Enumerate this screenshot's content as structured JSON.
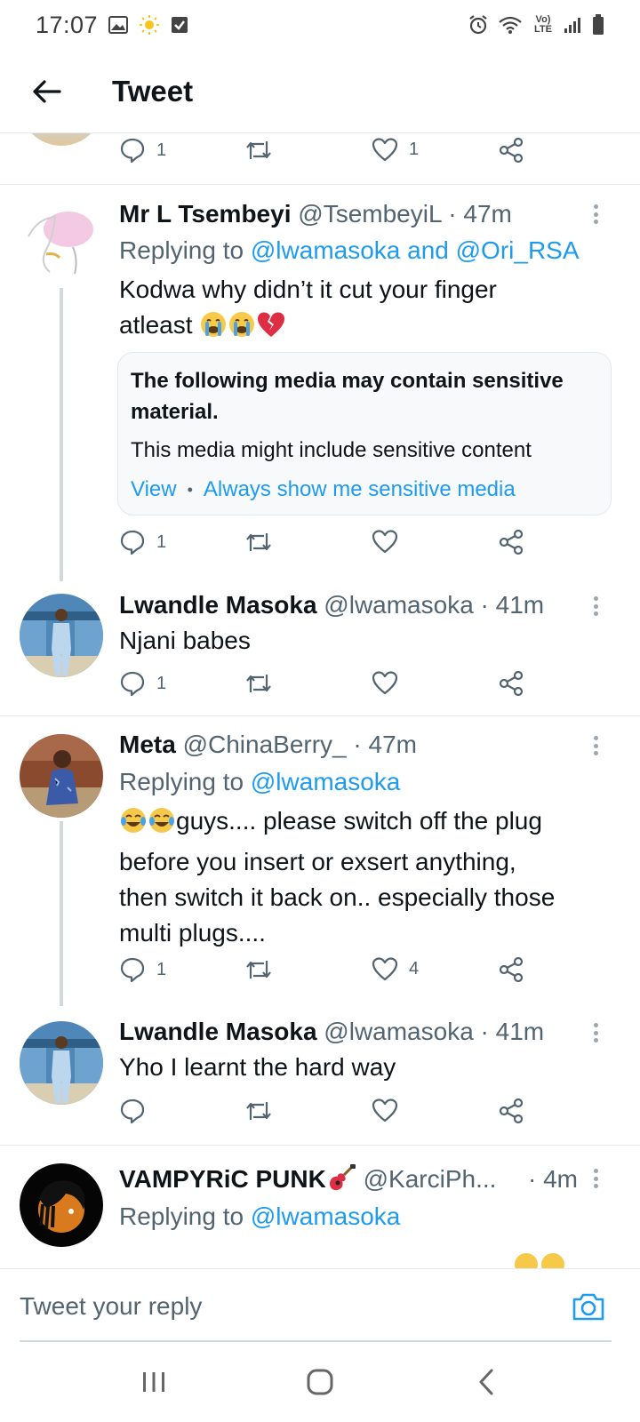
{
  "status_bar": {
    "time": "17:07",
    "network_label": "Vo) LTE"
  },
  "header": {
    "title": "Tweet"
  },
  "top_actions": {
    "replies": "1",
    "retweets": "",
    "likes": "1"
  },
  "tweets": [
    {
      "name": "Mr L Tsembeyi",
      "meta": "@TsembeyiL · 47m",
      "replying_prefix": "Replying to ",
      "replying_to": "@lwamasoka and @Ori_RSA",
      "text_line1": "Kodwa why didn’t it cut your finger",
      "text_line2": "atleast",
      "sensitive": {
        "title": "The following media may contain sensitive material.",
        "body": "This media might include sensitive content",
        "view": "View",
        "separator": "•",
        "always": "Always show me sensitive media"
      },
      "replies": "1",
      "likes": ""
    },
    {
      "name": "Lwandle Masoka",
      "meta": "@lwamasoka · 41m",
      "text": "Njani babes",
      "replies": "1",
      "likes": ""
    },
    {
      "name": "Meta",
      "meta": "@ChinaBerry_ · 47m",
      "replying_prefix": "Replying to ",
      "replying_to": "@lwamasoka",
      "text_line1": "guys.... please switch off the plug",
      "text_line2": "before you insert or exsert anything,",
      "text_line3": "then switch it back on.. especially those",
      "text_line4": "multi plugs....",
      "replies": "1",
      "likes": "4"
    },
    {
      "name": "Lwandle Masoka",
      "meta": "@lwamasoka · 41m",
      "text": "Yho I learnt the hard way",
      "replies": "",
      "likes": ""
    },
    {
      "name": "VAMPYRiC PUNK",
      "meta": "@KarciPh...",
      "time": "· 4m",
      "replying_prefix": "Replying to ",
      "replying_to": "@lwamasoka"
    }
  ],
  "reply_bar": {
    "placeholder": "Tweet your reply"
  },
  "colors": {
    "accent": "#1d9bf0",
    "text": "#0f1419",
    "muted": "#536471"
  }
}
